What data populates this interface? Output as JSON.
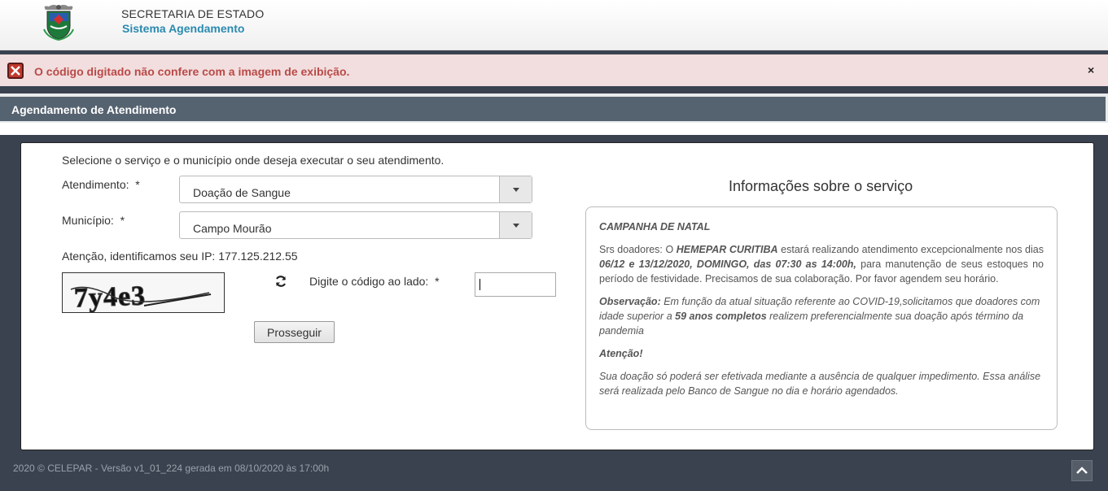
{
  "header": {
    "title": "SECRETARIA DE ESTADO",
    "subtitle": "Sistema Agendamento",
    "logo_icon": "parana-coat-of-arms-icon"
  },
  "alert": {
    "message": "O código digitado não confere com a imagem de exibição.",
    "close_label": "×",
    "icon": "error-x-icon",
    "color": "#b94a48"
  },
  "section": {
    "title": "Agendamento de Atendimento"
  },
  "form": {
    "intro": "Selecione o serviço e o município onde deseja executar o seu atendimento.",
    "atendimento_label": "Atendimento:",
    "atendimento_value": "Doação de Sangue",
    "municipio_label": "Município:",
    "municipio_value": "Campo Mourão",
    "required_mark": "*",
    "ip_notice": "Atenção, identificamos seu IP: 177.125.212.55",
    "captcha_text": "7y4e3",
    "refresh_icon": "refresh-icon",
    "code_label": "Digite o código ao lado:",
    "code_value": "",
    "submit_label": "Prosseguir"
  },
  "info": {
    "title": "Informações sobre o serviço",
    "campaign_heading": "CAMPANHA DE NATAL",
    "p1_a": "Srs doadores: O ",
    "p1_b": "HEMEPAR CURITIBA",
    "p1_c": " estará realizando atendimento excepcionalmente nos dias ",
    "p1_d": "06/12 e 13/12/2020, DOMINGO, das 07:30 as 14:00h,",
    "p1_e": " para manutenção de seus estoques no período de festividade. Precisamos de sua colaboração. Por favor agendem seu horário.",
    "obs_label": "Observação:",
    "obs_a": " Em função da atual situação referente ao COVID-19,solicitamos que doadores com idade superior a ",
    "obs_b": "59 anos completos",
    "obs_c": " realizem preferencialmente sua doação após término da pandemia",
    "attention": "Atenção!",
    "final": "Sua doação só poderá ser efetivada mediante a ausência de qualquer impedimento. Essa análise será realizada pelo Banco de Sangue no dia e horário agendados."
  },
  "footer": {
    "text": "2020 © CELEPAR - Versão v1_01_224 gerada em 08/10/2020 às 17:00h",
    "scroll_icon": "chevron-up-icon"
  }
}
